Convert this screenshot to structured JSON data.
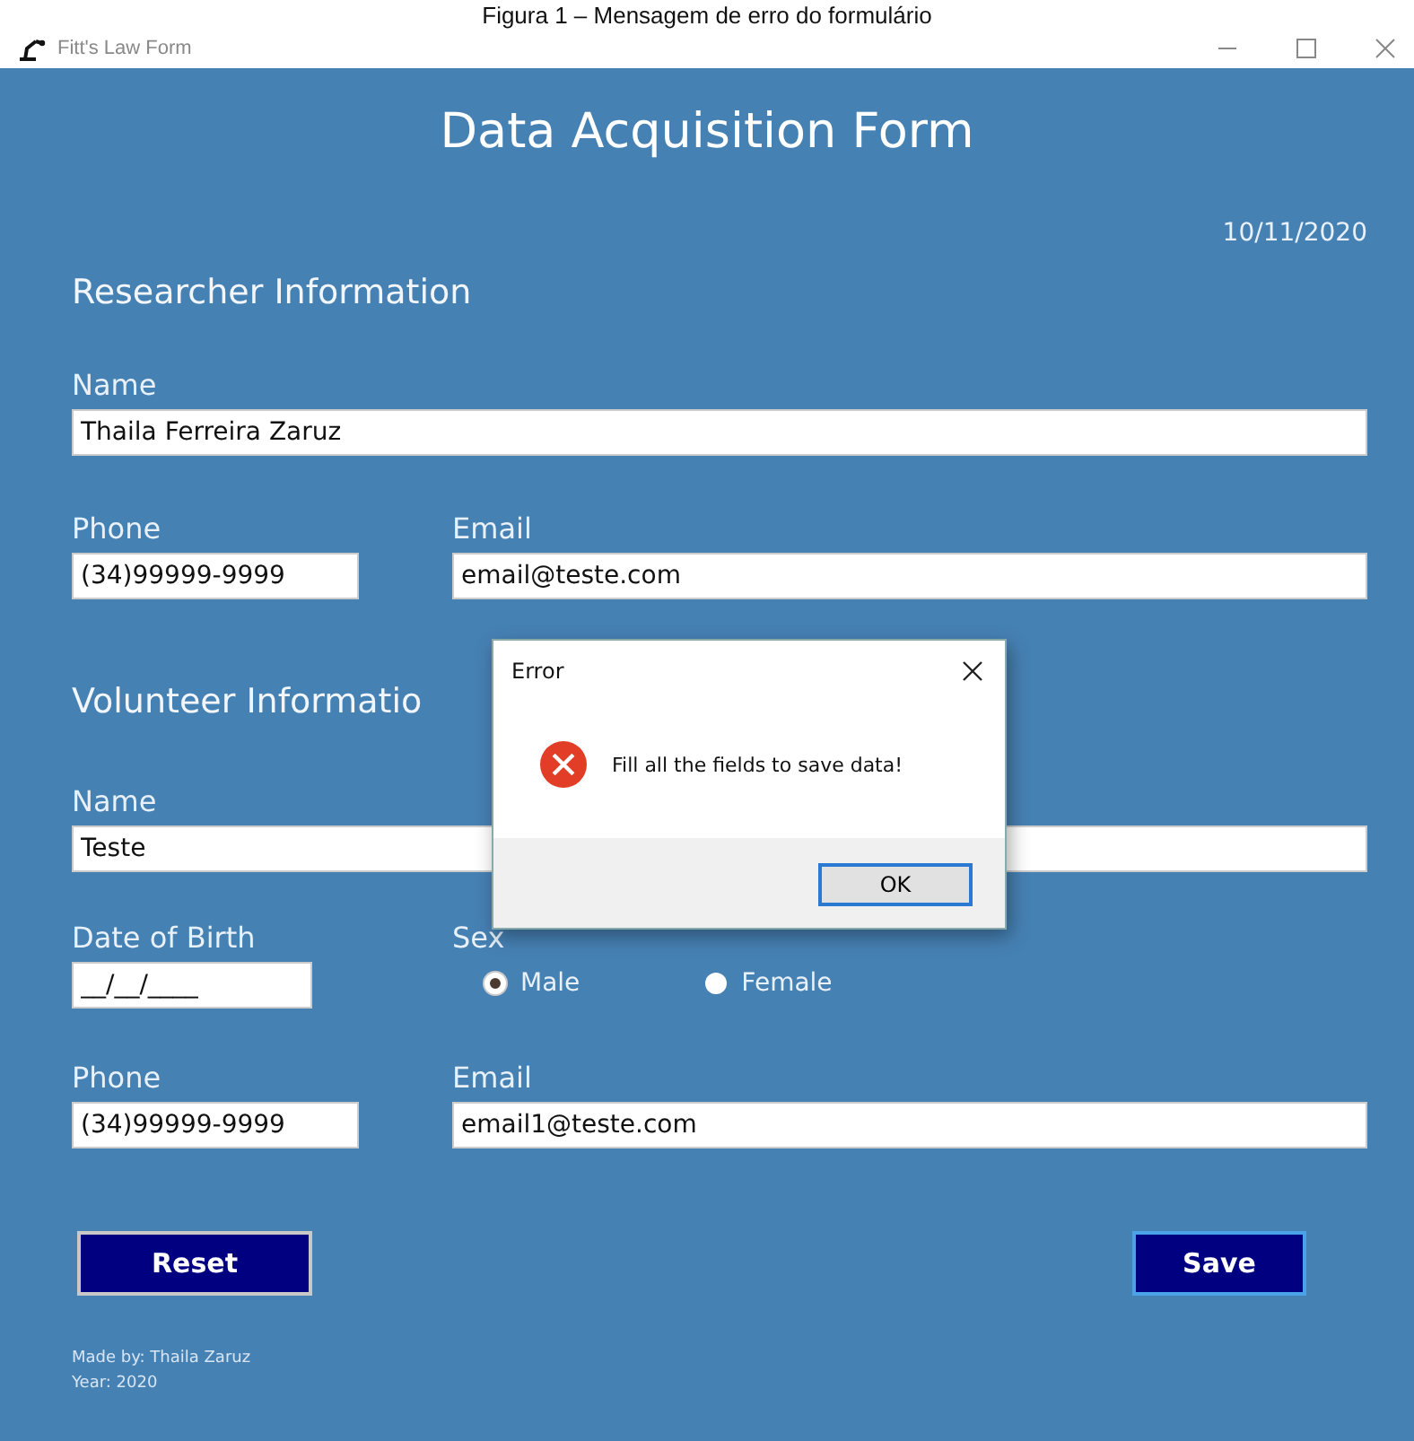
{
  "caption": "Figura 1 – Mensagem de erro do formulário",
  "window": {
    "title": "Fitt's Law Form"
  },
  "form": {
    "title": "Data Acquisition Form",
    "date": "10/11/2020",
    "researcher": {
      "heading": "Researcher Information",
      "name_label": "Name",
      "name_value": "Thaila Ferreira Zaruz",
      "phone_label": "Phone",
      "phone_value": "(34)99999-9999",
      "email_label": "Email",
      "email_value": "email@teste.com"
    },
    "volunteer": {
      "heading": "Volunteer Informatio",
      "name_label": "Name",
      "name_value": "Teste",
      "dob_label": "Date of Birth",
      "dob_value": "__/__/____",
      "sex_label": "Sex",
      "sex_options": [
        {
          "label": "Male",
          "selected": true
        },
        {
          "label": "Female",
          "selected": false
        }
      ],
      "phone_label": "Phone",
      "phone_value": "(34)99999-9999",
      "email_label": "Email",
      "email_value": "email1@teste.com"
    },
    "buttons": [
      {
        "label": "Reset",
        "focused": false
      },
      {
        "label": "Save",
        "focused": true
      }
    ],
    "footer": [
      "Made by: Thaila Zaruz",
      "Year: 2020"
    ]
  },
  "dialog": {
    "title": "Error",
    "message": "Fill all the fields to save data!",
    "button": "OK"
  }
}
